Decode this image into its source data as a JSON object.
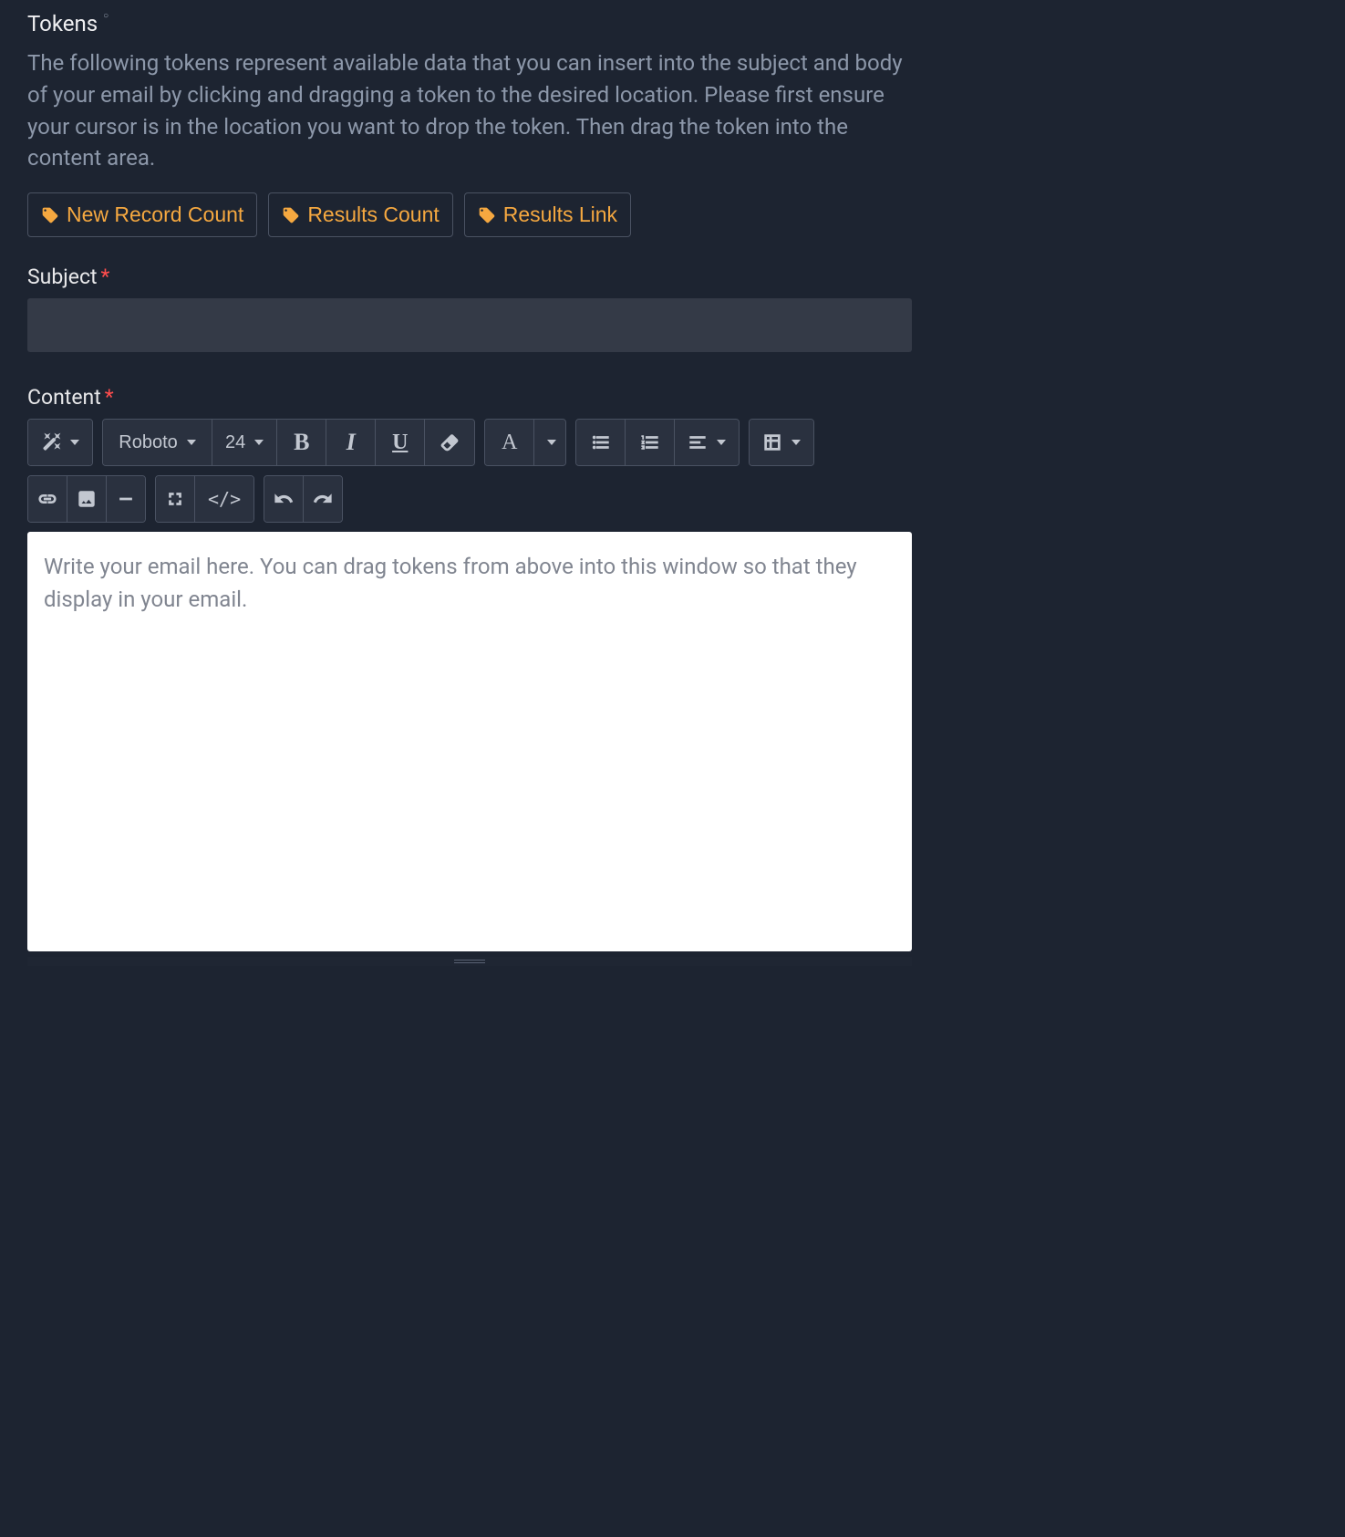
{
  "tokens_section": {
    "title": "Tokens",
    "description": "The following tokens represent available data that you can insert into the subject and body of your email by clicking and dragging a token to the desired location. Please first ensure your cursor is in the location you want to drop the token. Then drag the token into the content area.",
    "items": [
      {
        "label": "New Record Count"
      },
      {
        "label": "Results Count"
      },
      {
        "label": "Results Link"
      }
    ]
  },
  "subject": {
    "label": "Subject",
    "required_mark": "*",
    "value": ""
  },
  "content": {
    "label": "Content",
    "required_mark": "*",
    "placeholder": "Write your email here. You can drag tokens from above into this window so that they display in your email."
  },
  "toolbar": {
    "font_family": "Roboto",
    "font_size": "24"
  }
}
